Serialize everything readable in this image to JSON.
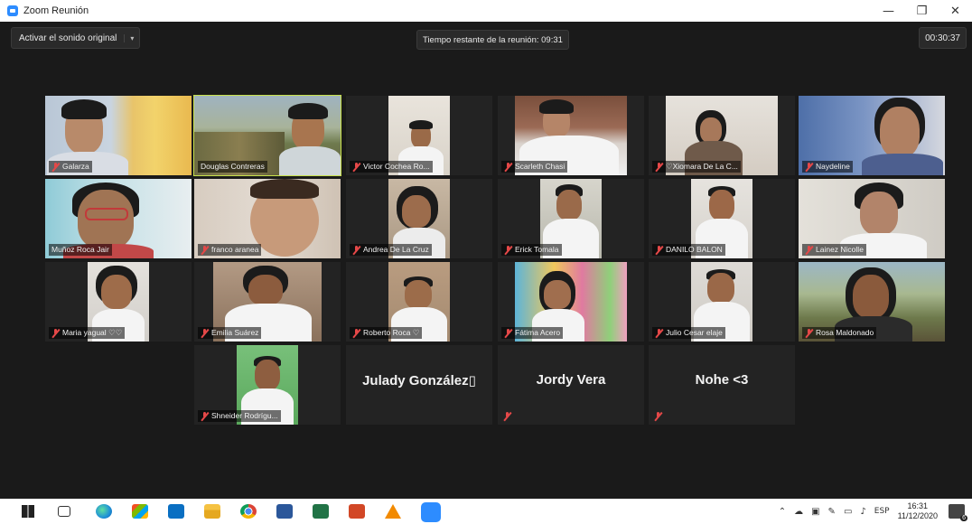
{
  "window": {
    "title": "Zoom Reunión",
    "minimize": "—",
    "maximize": "❐",
    "close": "✕"
  },
  "topbar": {
    "audio_label": "Activar el sonido original",
    "audio_caret": "▾",
    "remaining": "Tiempo restante de la reunión: 09:31",
    "elapsed": "00:30:37"
  },
  "participants": [
    {
      "name": "Galarza",
      "muted": true
    },
    {
      "name": "Douglas Contreras",
      "muted": false,
      "active_speaker": true
    },
    {
      "name": "Victor Cochea Ro...",
      "muted": true
    },
    {
      "name": "Scarleth Chasi",
      "muted": true
    },
    {
      "name": "♡Xiomara De La C...",
      "muted": true
    },
    {
      "name": "Naydeline",
      "muted": true
    },
    {
      "name": "Muñoz Roca Jair",
      "muted": false
    },
    {
      "name": "franco aranea",
      "muted": true
    },
    {
      "name": "Andrea De La Cruz",
      "muted": true
    },
    {
      "name": "Erick Tomala",
      "muted": true
    },
    {
      "name": "DANILO BALON",
      "muted": true
    },
    {
      "name": "Lainez Nicolle",
      "muted": true
    },
    {
      "name": "Maria yagual ♡♡",
      "muted": true
    },
    {
      "name": "Emilia Suárez",
      "muted": true
    },
    {
      "name": "Roberto Roca ♡",
      "muted": true
    },
    {
      "name": "Fátima Acero",
      "muted": true
    },
    {
      "name": "Julio Cesar elaje",
      "muted": true
    },
    {
      "name": "Rosa Maldonado",
      "muted": true
    },
    {
      "name": "Shneider Rodrígu...",
      "muted": true
    },
    {
      "name": "Julady  González▯",
      "muted": false,
      "video_off": true
    },
    {
      "name": "Jordy Vera",
      "muted": true,
      "video_off": true
    },
    {
      "name": "Nohe <3",
      "muted": true,
      "video_off": true
    }
  ],
  "taskbar": {
    "language": "ESP",
    "time": "16:31",
    "date": "11/12/2020",
    "notifications": "6"
  },
  "colors": {
    "active_speaker": "#c7e04a",
    "muted_mic": "#e54848",
    "zoom_blue": "#2d8cff"
  }
}
